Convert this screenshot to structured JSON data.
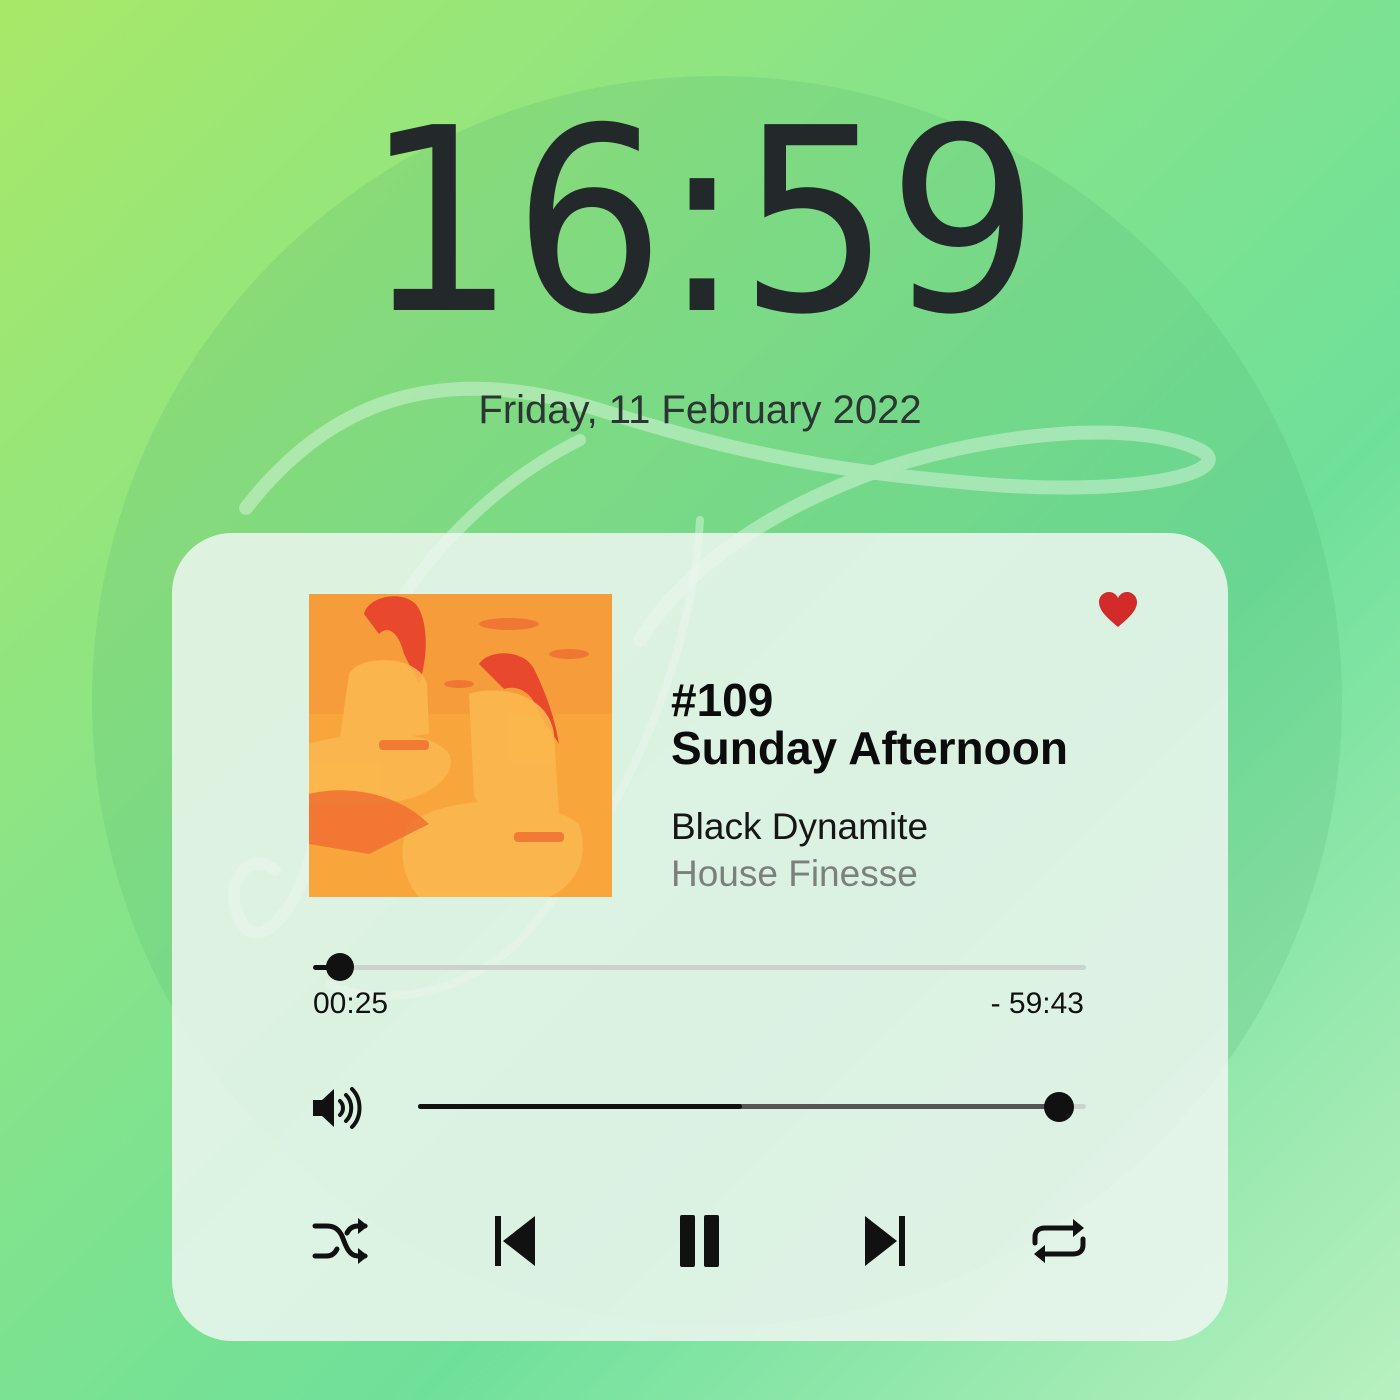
{
  "lock_screen": {
    "time": "16:59",
    "date": "Friday, 11 February 2022"
  },
  "player": {
    "episode": "#109",
    "title": "Sunday Afternoon",
    "artist": "Black Dynamite",
    "album": "House Finesse",
    "elapsed": "00:25",
    "remaining": "- 59:43",
    "playback_progress_fraction": 0.035,
    "volume_fraction": 0.96,
    "volume_buffer_fraction": 0.485,
    "favorite": true,
    "state": "playing"
  },
  "controls": {
    "icons": [
      "shuffle-icon",
      "skip-previous-icon",
      "pause-icon",
      "skip-next-icon",
      "repeat-icon",
      "volume-icon",
      "heart-icon"
    ]
  },
  "colors": {
    "accent_heart": "#d32a2a",
    "control": "#111111",
    "album_text": "#7b807c",
    "cover_orange": "#f7a43a",
    "cover_red": "#e9442a"
  }
}
